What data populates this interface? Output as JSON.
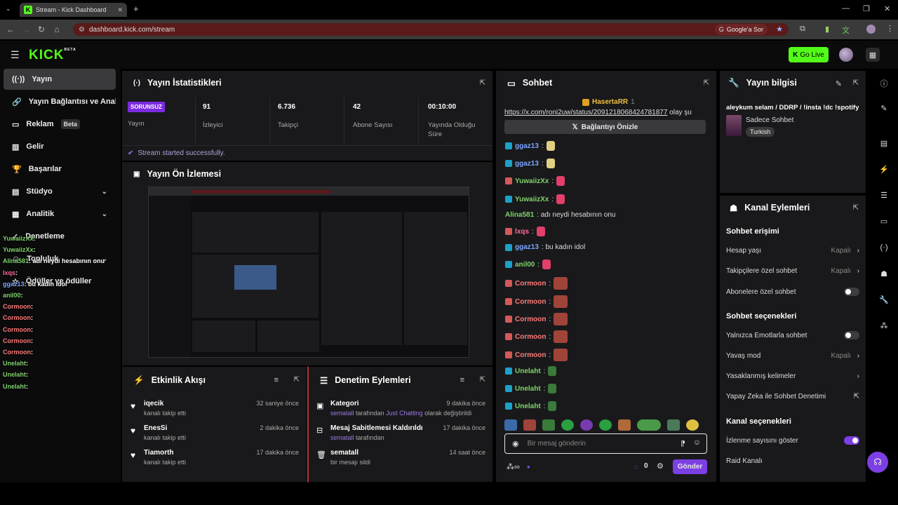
{
  "browser": {
    "tab_title": "Stream - Kick Dashboard",
    "url": "dashboard.kick.com/stream",
    "google_pill": "Google'a Sor"
  },
  "header": {
    "logo": "KICK",
    "logo_sup": "BETA",
    "go_live": "Go Live"
  },
  "sidebar": {
    "items": [
      {
        "label": "Yayın",
        "icon": "broadcast-icon"
      },
      {
        "label": "Yayın Bağlantısı ve Anahtarı",
        "icon": "link-icon"
      },
      {
        "label": "Reklam",
        "icon": "ad-icon",
        "badge": "Beta"
      },
      {
        "label": "Gelir",
        "icon": "revenue-icon"
      },
      {
        "label": "Başarılar",
        "icon": "trophy-icon"
      },
      {
        "label": "Stüdyo",
        "icon": "studio-icon"
      },
      {
        "label": "Analitik",
        "icon": "analytics-icon"
      },
      {
        "label": "Denetleme",
        "icon": "moderation-icon"
      },
      {
        "label": "Topluluk",
        "icon": "community-icon"
      },
      {
        "label": "Ödüller ve ödüller",
        "icon": "rewards-icon"
      }
    ]
  },
  "overlay_chat": [
    {
      "user": "YuwaiizXx",
      "text": ":",
      "color": "#7fd36a"
    },
    {
      "user": "YuwaiizXx",
      "text": ":",
      "color": "#7fd36a"
    },
    {
      "user": "Alina581",
      "text": ": adı neydi hesabının onu",
      "color": "#7fd36a"
    },
    {
      "user": "lxqs",
      "text": ":",
      "color": "#ff6a9a"
    },
    {
      "user": "ggaz13",
      "text": ": bu kadın idol",
      "color": "#7aa7ff"
    },
    {
      "user": "anil00",
      "text": ":",
      "color": "#7fd36a"
    },
    {
      "user": "Cormoon",
      "text": ":",
      "color": "#ff7a7a"
    },
    {
      "user": "Cormoon",
      "text": ":",
      "color": "#ff7a7a"
    },
    {
      "user": "Cormoon",
      "text": ":",
      "color": "#ff7a7a"
    },
    {
      "user": "Cormoon",
      "text": ":",
      "color": "#ff7a7a"
    },
    {
      "user": "Cormoon",
      "text": ":",
      "color": "#ff7a7a"
    },
    {
      "user": "Unelaht",
      "text": ":",
      "color": "#7fd36a"
    },
    {
      "user": "Unelaht",
      "text": ":",
      "color": "#7fd36a"
    },
    {
      "user": "Unelaht",
      "text": ":",
      "color": "#7fd36a"
    }
  ],
  "stats": {
    "title": "Yayın İstatistikleri",
    "status_badge": "SORUNSUZ",
    "status_label": "Yayın",
    "viewers": "91",
    "viewers_label": "İzleyici",
    "followers": "6.736",
    "followers_label": "Takipçi",
    "subs": "42",
    "subs_label": "Abone Sayısı",
    "duration": "00:10:00",
    "duration_label": "Yayında Olduğu Süre",
    "success_msg": "Stream started successfully."
  },
  "preview": {
    "title": "Yayın Ön İzlemesi"
  },
  "activity": {
    "title": "Etkinlik Akışı",
    "items": [
      {
        "name": "iqecik",
        "sub": "kanalı takip etti",
        "time": "32 saniye önce"
      },
      {
        "name": "EnesSi",
        "sub": "kanalı takip etti",
        "time": "2 dakika önce"
      },
      {
        "name": "Tiamorth",
        "sub": "kanalı takip etti",
        "time": "17 dakika önce"
      }
    ]
  },
  "modlog": {
    "title": "Denetim Eylemleri",
    "items": [
      {
        "name": "Kategori",
        "sub_user": "sematall",
        "sub_mid": " tarafından ",
        "sub_hl": "Just Chatting",
        "sub_end": " olarak değiştirildi",
        "time": "9 dakika önce"
      },
      {
        "name": "Mesaj Sabitlemesi Kaldırıldı",
        "sub_user": "sematall",
        "sub_mid": " tarafından",
        "sub_hl": "",
        "sub_end": "",
        "time": "17 dakika önce"
      },
      {
        "name": "sematall",
        "sub_user": "",
        "sub_mid": "bir mesajı sildi",
        "sub_hl": "",
        "sub_end": "",
        "time": "14 saat önce"
      }
    ]
  },
  "chat": {
    "title": "Sohbet",
    "pinned_user": "HasertaRR",
    "pinned_count": "1",
    "pinned_link": "https://x.com/roni2uw/status/2091218068424781877",
    "pinned_rest": " olay şu",
    "preview_btn": "Bağlantıyı Önizle",
    "messages": [
      {
        "user": "ggaz13",
        "text": ":",
        "color": "#7aa7ff",
        "plat": "#1da1c8"
      },
      {
        "user": "ggaz13",
        "text": ":",
        "color": "#7aa7ff",
        "plat": "#1da1c8"
      },
      {
        "user": "YuwaiizXx",
        "text": ":",
        "color": "#7fd36a",
        "plat": "#d45a5a"
      },
      {
        "user": "YuwaiizXx",
        "text": ":",
        "color": "#7fd36a",
        "plat": "#1da1c8"
      },
      {
        "user": "Alina581",
        "text": ": adı neydi hesabının onu",
        "color": "#7fd36a",
        "plat": ""
      },
      {
        "user": "lxqs",
        "text": ":",
        "color": "#ff6a9a",
        "plat": "#d45a5a"
      },
      {
        "user": "ggaz13",
        "text": ": bu kadın idol",
        "color": "#7aa7ff",
        "plat": "#1da1c8"
      },
      {
        "user": "anil00",
        "text": ":",
        "color": "#7fd36a",
        "plat": "#1da1c8"
      },
      {
        "user": "Cormoon",
        "text": ":",
        "color": "#ff7a7a",
        "plat": "#d45a5a"
      },
      {
        "user": "Cormoon",
        "text": ":",
        "color": "#ff7a7a",
        "plat": "#d45a5a"
      },
      {
        "user": "Cormoon",
        "text": ":",
        "color": "#ff7a7a",
        "plat": "#d45a5a"
      },
      {
        "user": "Cormoon",
        "text": ":",
        "color": "#ff7a7a",
        "plat": "#d45a5a"
      },
      {
        "user": "Cormoon",
        "text": ":",
        "color": "#ff7a7a",
        "plat": "#d45a5a"
      },
      {
        "user": "Unelaht",
        "text": ":",
        "color": "#7fd36a",
        "plat": "#1da1c8"
      },
      {
        "user": "Unelaht",
        "text": ":",
        "color": "#7fd36a",
        "plat": "#1da1c8"
      },
      {
        "user": "Unelaht",
        "text": ":",
        "color": "#7fd36a",
        "plat": "#1da1c8"
      }
    ],
    "input_placeholder": "Bir mesaj gönderin",
    "count": "0",
    "send": "Gönder"
  },
  "stream_info": {
    "title": "Yayın bilgisi",
    "stream_title": "aleykum selam / DDRP / !insta !dc !spotify",
    "category": "Sadece Sohbet",
    "language": "Turkish"
  },
  "channel_actions": {
    "title": "Kanal Eylemleri",
    "sec1": "Sohbet erişimi",
    "account_age": "Hesap yaşı",
    "account_age_val": "Kapalı",
    "followers_only": "Takipçilere özel sohbet",
    "followers_only_val": "Kapalı",
    "subs_only": "Abonelere özel sohbet",
    "sec2": "Sohbet seçenekleri",
    "emote_only": "Yalnızca Emotlarla sohbet",
    "slow_mode": "Yavaş mod",
    "slow_mode_val": "Kapalı",
    "banned_words": "Yasaklanmış kelimeler",
    "ai_mod": "Yapay Zeka ile Sohbet Denetimi",
    "sec3": "Kanal seçenekleri",
    "show_viewers": "İzlenme sayısını göster",
    "raid": "Raid Kanalı"
  }
}
